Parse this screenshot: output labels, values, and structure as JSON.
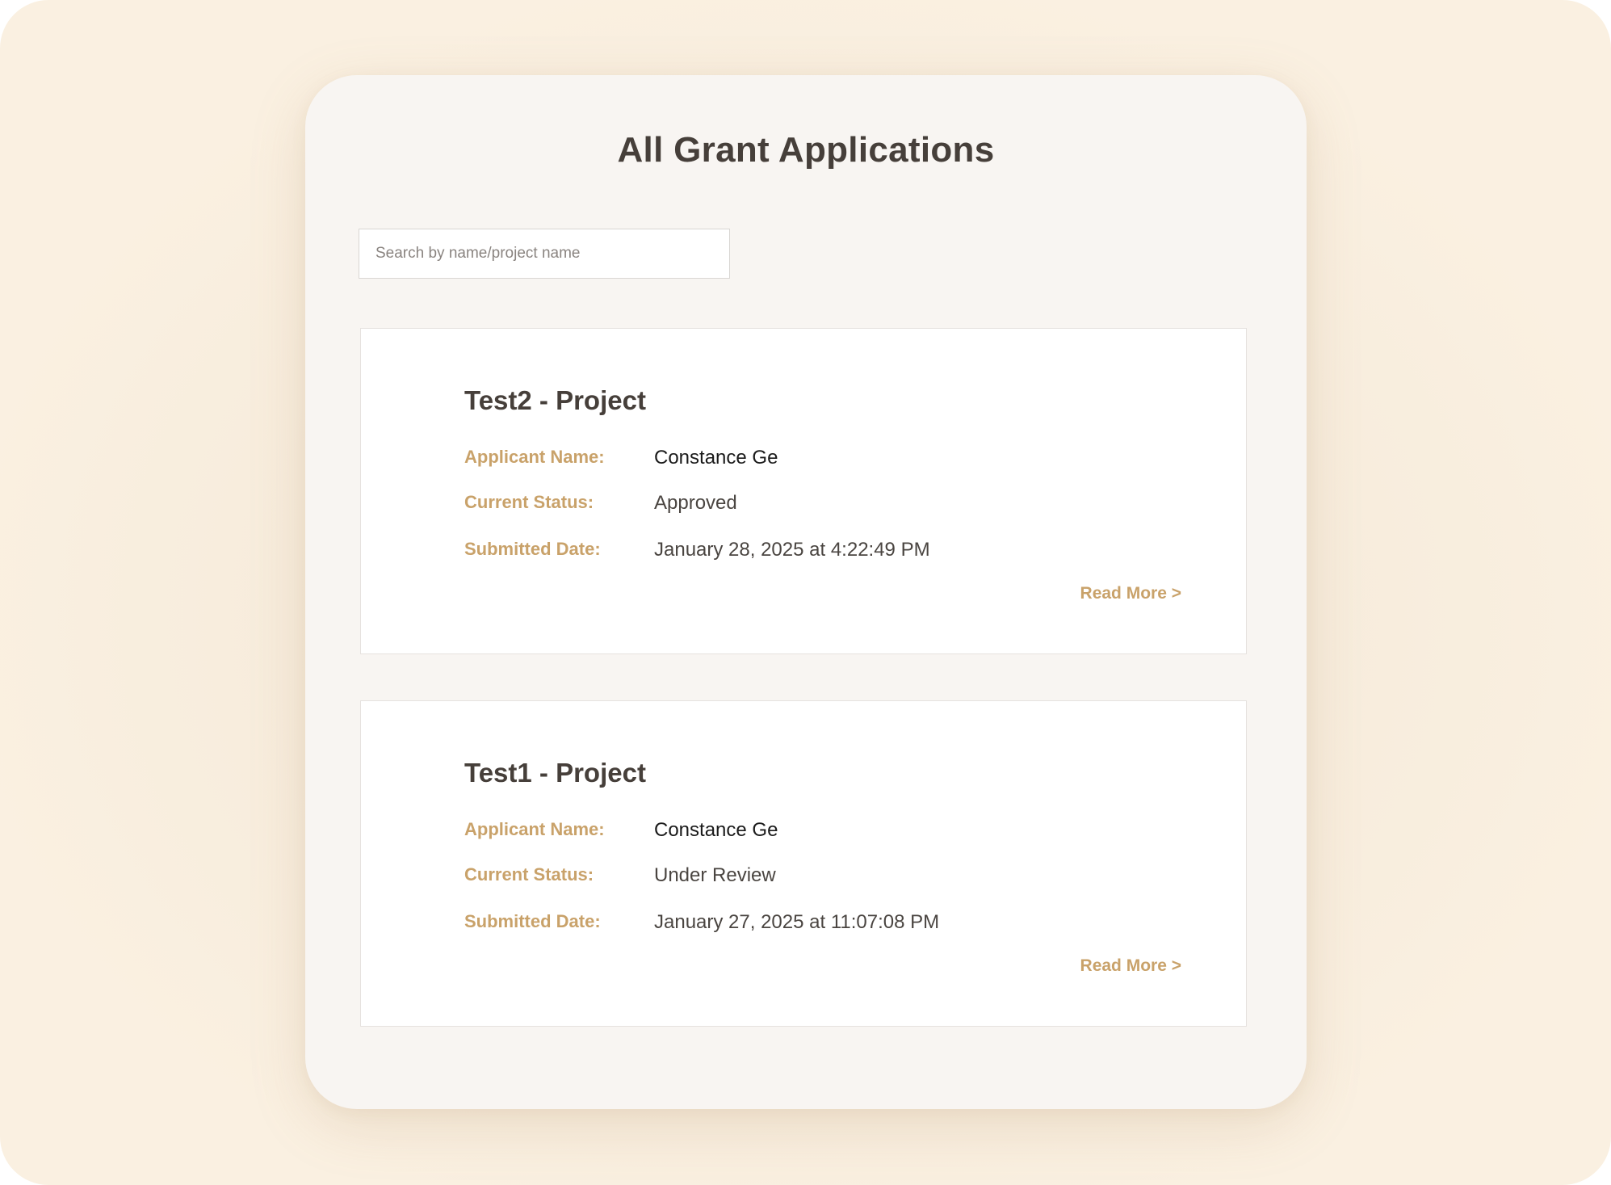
{
  "page": {
    "title": "All Grant Applications"
  },
  "search": {
    "placeholder": "Search by name/project name",
    "value": ""
  },
  "labels": {
    "applicant_name": "Applicant Name:",
    "current_status": "Current Status:",
    "submitted_date": "Submitted Date:",
    "read_more": "Read More >"
  },
  "applications": [
    {
      "title": "Test2 - Project",
      "applicant_name": "Constance Ge",
      "status": "Approved",
      "submitted_date": "January 28, 2025 at 4:22:49 PM"
    },
    {
      "title": "Test1 - Project",
      "applicant_name": "Constance Ge",
      "status": "Under Review",
      "submitted_date": "January 27, 2025 at 11:07:08 PM"
    }
  ],
  "colors": {
    "background": "#faf0e1",
    "panel": "#f8f5f2",
    "card": "#ffffff",
    "heading": "#463f3a",
    "accent": "#c9a26a",
    "text": "#4a4541"
  }
}
